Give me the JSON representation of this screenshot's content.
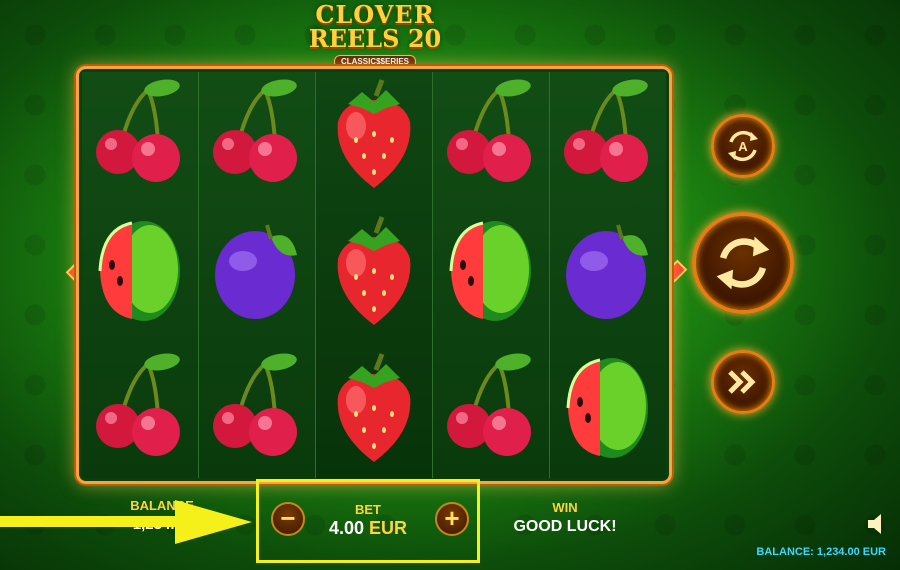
{
  "game": {
    "title_line1": "CLOVER",
    "title_line2": "REELS 20",
    "title_line3": "CLASSIC$$ERIES"
  },
  "reels": [
    [
      "cherry",
      "watermelon",
      "cherry"
    ],
    [
      "cherry",
      "plum",
      "cherry"
    ],
    [
      "strawberry",
      "strawberry",
      "strawberry"
    ],
    [
      "cherry",
      "watermelon",
      "cherry"
    ],
    [
      "cherry",
      "plum",
      "watermelon"
    ]
  ],
  "controls": {
    "autoplay_icon": "autoplay-icon",
    "autoplay_letter": "A",
    "spin_icon": "spin-icon",
    "turbo_icon": "turbo-icon"
  },
  "bet": {
    "label": "BET",
    "amount": "4.00",
    "currency": "EUR",
    "minus": "−",
    "plus": "+"
  },
  "balance_panel": {
    "label": "BALANCE",
    "value": "1,234.00"
  },
  "win": {
    "label": "WIN",
    "message": "GOOD LUCK!"
  },
  "footer": {
    "balance_text": "BALANCE: 1,234.00 EUR"
  },
  "colors": {
    "highlight": "#f5ef1a",
    "accent": "#ffd43a",
    "balance_text": "#3fd6ff"
  }
}
